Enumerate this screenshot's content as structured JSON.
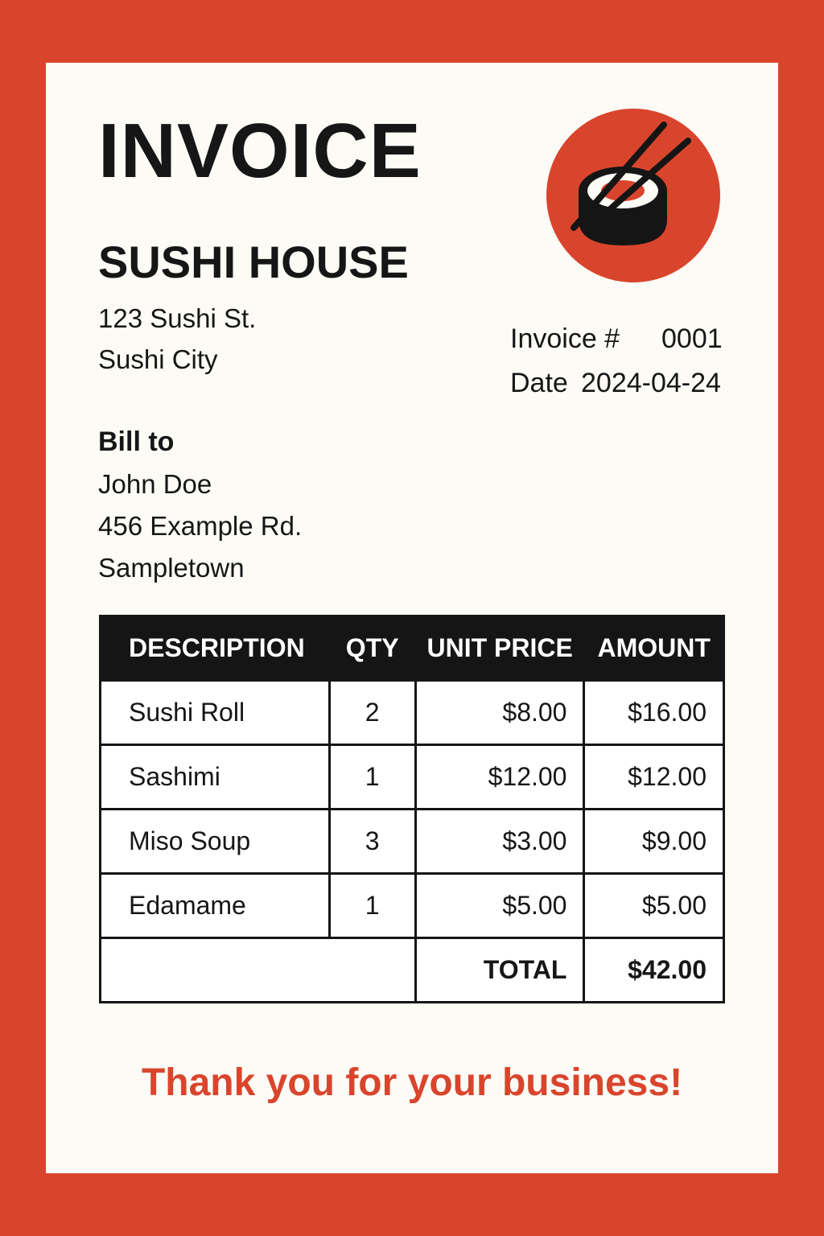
{
  "invoice": {
    "title": "INVOICE",
    "company": {
      "name": "SUSHI HOUSE",
      "address_line1": "123 Sushi St.",
      "address_line2": "Sushi City"
    },
    "logo_icon": "sushi-chopsticks-icon",
    "meta": {
      "invoice_label": "Invoice #",
      "invoice_number": "0001",
      "date_label": "Date",
      "date": "2024-04-24"
    },
    "bill_to": {
      "label": "Bill to",
      "name": "John Doe",
      "address_line1": "456 Example Rd.",
      "address_line2": "Sampletown"
    },
    "table": {
      "headers": [
        "DESCRIPTION",
        "QTY",
        "UNIT PRICE",
        "AMOUNT"
      ],
      "rows": [
        {
          "description": "Sushi Roll",
          "qty": "2",
          "unit_price": "$8.00",
          "amount": "$16.00"
        },
        {
          "description": "Sashimi",
          "qty": "1",
          "unit_price": "$12.00",
          "amount": "$12.00"
        },
        {
          "description": "Miso Soup",
          "qty": "3",
          "unit_price": "$3.00",
          "amount": "$9.00"
        },
        {
          "description": "Edamame",
          "qty": "1",
          "unit_price": "$5.00",
          "amount": "$5.00"
        }
      ],
      "total_label": "TOTAL",
      "total_value": "$42.00"
    },
    "footer": "Thank you for your business!"
  },
  "colors": {
    "accent": "#d9452c",
    "dark": "#151515",
    "paper": "#fdfbf6"
  }
}
